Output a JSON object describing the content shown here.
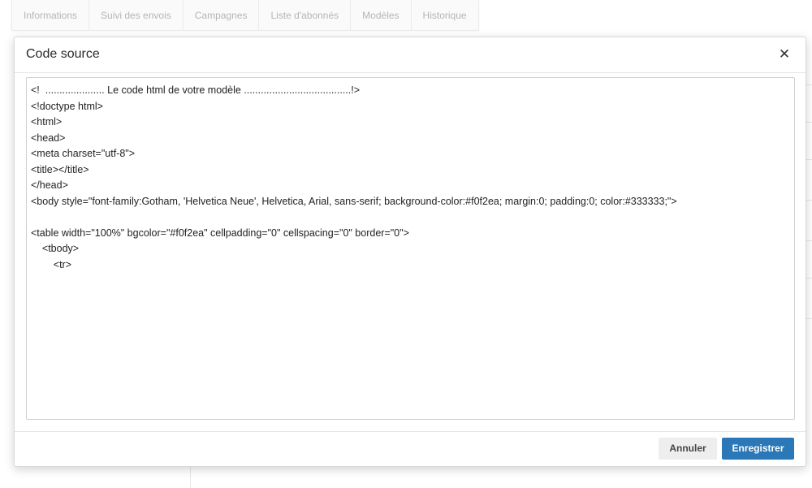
{
  "background": {
    "tabs": [
      "Informations",
      "Suivi des envois",
      "Campagnes",
      "Liste d'abonnés",
      "Modèles",
      "Historique"
    ]
  },
  "modal": {
    "title": "Code source",
    "close_icon": "close-icon",
    "code_lines": [
      "<!  ..................... Le code html de votre modèle ......................................!>",
      "<!doctype html>",
      "<html>",
      "<head>",
      "<meta charset=\"utf-8\">",
      "<title></title>",
      "</head>",
      "<body style=\"font-family:Gotham, 'Helvetica Neue', Helvetica, Arial, sans-serif; background-color:#f0f2ea; margin:0; padding:0; color:#333333;\">",
      "",
      "<table width=\"100%\" bgcolor=\"#f0f2ea\" cellpadding=\"0\" cellspacing=\"0\" border=\"0\">",
      "    <tbody>",
      "        <tr>"
    ],
    "cancel_label": "Annuler",
    "save_label": "Enregistrer"
  },
  "colors": {
    "primary": "#2a78b8",
    "tab_text": "#b5b5b5"
  }
}
